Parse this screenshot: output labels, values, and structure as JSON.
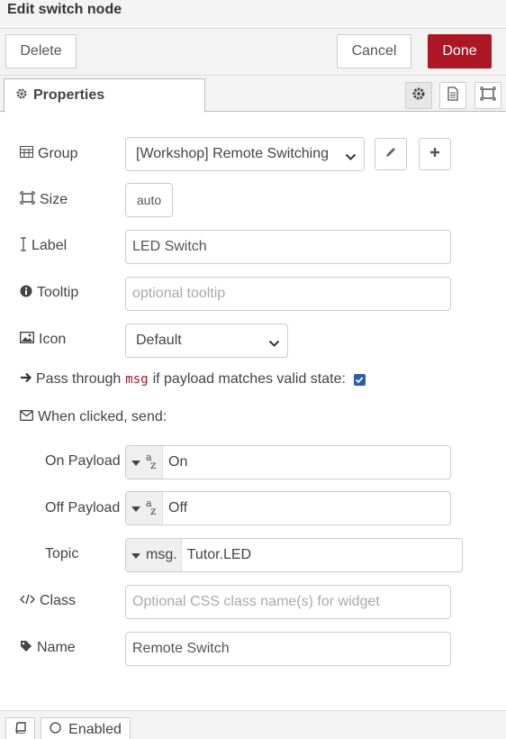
{
  "dialog": {
    "title": "Edit switch node"
  },
  "toolbar": {
    "delete_label": "Delete",
    "cancel_label": "Cancel",
    "done_label": "Done"
  },
  "tabs": {
    "properties_label": "Properties",
    "icons": [
      "gear-icon",
      "document-icon",
      "frame-icon"
    ]
  },
  "form": {
    "group": {
      "label": "Group",
      "value": "[Workshop] Remote Switching"
    },
    "size": {
      "label": "Size",
      "value": "auto"
    },
    "label": {
      "label": "Label",
      "value": "LED Switch"
    },
    "tooltip": {
      "label": "Tooltip",
      "placeholder": "optional tooltip"
    },
    "icon": {
      "label": "Icon",
      "value": "Default"
    },
    "passthrough": {
      "prefix": "Pass through",
      "code": "msg",
      "suffix": "if payload matches valid state:",
      "checked": true
    },
    "when_clicked": {
      "label": "When clicked, send:"
    },
    "on_payload": {
      "label": "On Payload",
      "value": "On"
    },
    "off_payload": {
      "label": "Off Payload",
      "value": "Off"
    },
    "topic": {
      "label": "Topic",
      "type": "msg.",
      "value": "Tutor.LED"
    },
    "class": {
      "label": "Class",
      "placeholder": "Optional CSS class name(s) for widget"
    },
    "name": {
      "label": "Name",
      "value": "Remote Switch"
    }
  },
  "footer": {
    "enabled_label": "Enabled"
  },
  "colors": {
    "accent": "#ad1625",
    "checkbox": "#2a5ea8"
  }
}
